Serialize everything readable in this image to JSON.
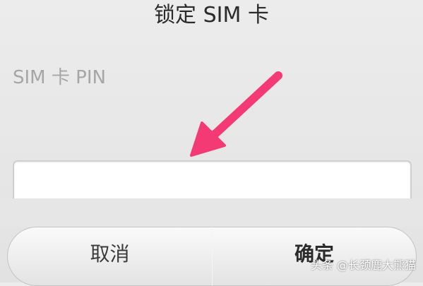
{
  "dialog": {
    "title": "锁定 SIM 卡",
    "pin_label": "SIM 卡 PIN",
    "pin_input": {
      "value": "",
      "placeholder": ""
    },
    "buttons": {
      "cancel_label": "取消",
      "ok_label": "确定"
    }
  },
  "overlay": {
    "arrow_color": "#f43a74",
    "watermark": "头条 @长颈鹿大熊猫"
  }
}
